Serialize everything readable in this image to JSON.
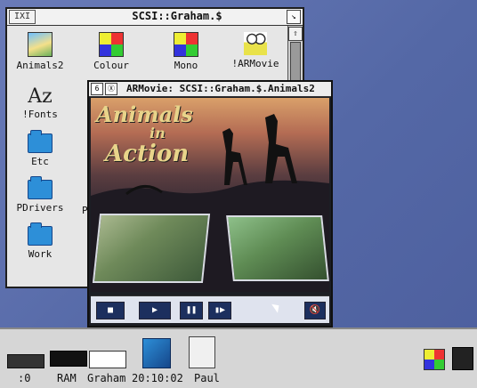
{
  "filer": {
    "close": "IXI",
    "title": "SCSI::Graham.$",
    "toggle": "↘",
    "scroll_up": "⇧",
    "items": [
      {
        "label": "Animals2"
      },
      {
        "label": "Colour"
      },
      {
        "label": "Mono"
      },
      {
        "label": "!ARMovie"
      },
      {
        "label": "!Fonts"
      },
      {
        "label": "Etc"
      },
      {
        "label": "PDrivers"
      },
      {
        "label": "Work"
      }
    ],
    "az_glyph": "Az",
    "partial_label": "P"
  },
  "movie": {
    "title": "ARMovie: SCSI::Graham.$.Animals2",
    "close_btn": "6",
    "back_btn": "Ⓧ",
    "headline_top": "Animals",
    "headline_in": "in",
    "headline_bottom": "Action",
    "controls": {
      "stop": "■",
      "play": "▶",
      "pause": "❚❚",
      "step": "▮▶",
      "mute": "🔇"
    }
  },
  "iconbar": {
    "drive_label": ":0",
    "ram_label": "RAM",
    "user_label": "Graham",
    "clock_label": "20:10:02",
    "paul_label": "Paul"
  },
  "colors": {
    "desktop": "#5a6aa8",
    "window": "#e6e6e6",
    "folder": "#2d8fd8",
    "control": "#1c2f5e"
  }
}
